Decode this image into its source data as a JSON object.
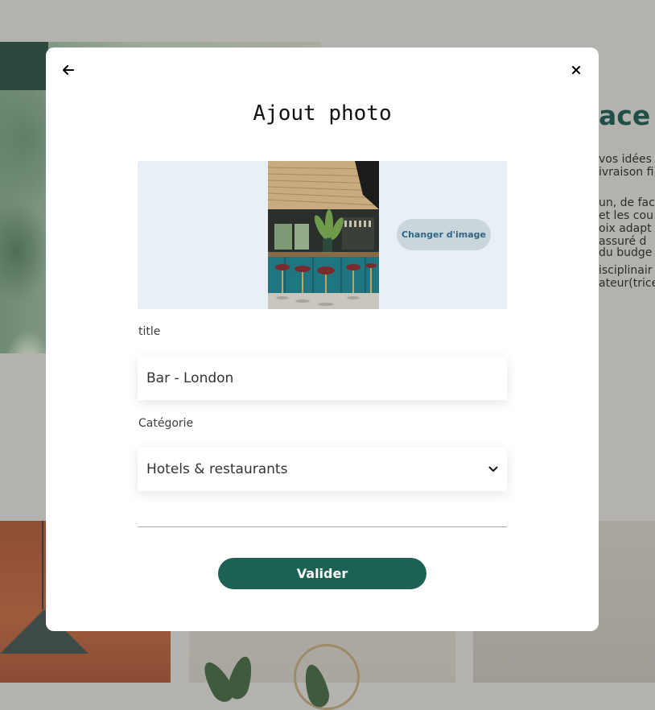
{
  "background_page": {
    "heading_fragment": "ace",
    "text_lines": [
      "vos idées",
      "ivraison fi",
      "un, de fac",
      "et les cou",
      "oix adapt",
      "assuré d",
      "du budge",
      "isciplinair",
      "ateur(trice"
    ]
  },
  "modal": {
    "back_icon": "arrow-left-icon",
    "close_icon": "close-icon",
    "title": "Ajout photo",
    "change_image_label": "Changer d'image",
    "title_label": "title",
    "title_value": "Bar - London",
    "category_label": "Catégorie",
    "category_value": "Hotels & restaurants",
    "dropdown_icon": "chevron-down-icon",
    "submit_label": "Valider"
  },
  "colors": {
    "overlay": "#b3b2ae",
    "accent": "#1d6154",
    "image_zone": "#e8f0f6",
    "change_button_bg": "#cbd6dc",
    "change_button_text": "#306685"
  }
}
